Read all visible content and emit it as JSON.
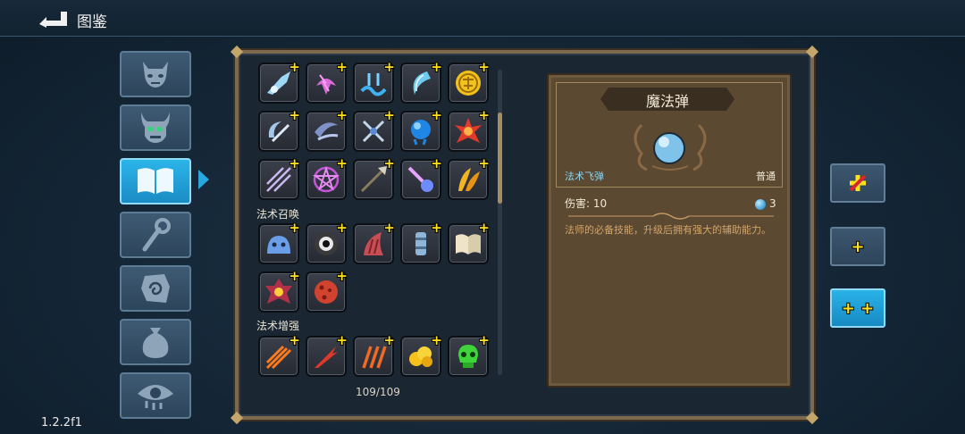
{
  "header": {
    "title": "图鉴"
  },
  "sidebar": {
    "items": [
      {
        "name": "monster",
        "icon": "demon-face-icon",
        "active": false
      },
      {
        "name": "boss",
        "icon": "horned-skull-icon",
        "active": false
      },
      {
        "name": "spellbook",
        "icon": "open-book-icon",
        "active": true
      },
      {
        "name": "staff",
        "icon": "staff-icon",
        "active": false
      },
      {
        "name": "relic",
        "icon": "spiral-stone-icon",
        "active": false
      },
      {
        "name": "items",
        "icon": "pouch-icon",
        "active": false
      },
      {
        "name": "curse",
        "icon": "eye-icon",
        "active": false
      }
    ]
  },
  "grid": {
    "sections": [
      {
        "label": "法术召唤"
      },
      {
        "label": "法术增强"
      }
    ],
    "counter": "109/109",
    "plus_symbol": "+"
  },
  "detail": {
    "name": "魔法弹",
    "type": "法术飞弹",
    "rarity": "普通",
    "damage_label": "伤害: 10",
    "mana_cost": "3",
    "description": "法师的必备技能，升级后拥有强大的辅助能力。"
  },
  "right_buttons": [
    {
      "name": "remove-upgrade",
      "icon": "crossed-plus-icon"
    },
    {
      "name": "single-upgrade",
      "label": "+"
    },
    {
      "name": "double-upgrade",
      "label": "+ +"
    }
  ],
  "version": "1.2.2f1",
  "colors": {
    "accent": "#2aa7de",
    "plus": "#ffe21a",
    "frame": "#7d6a4e",
    "type_text": "#8fd5f2"
  }
}
